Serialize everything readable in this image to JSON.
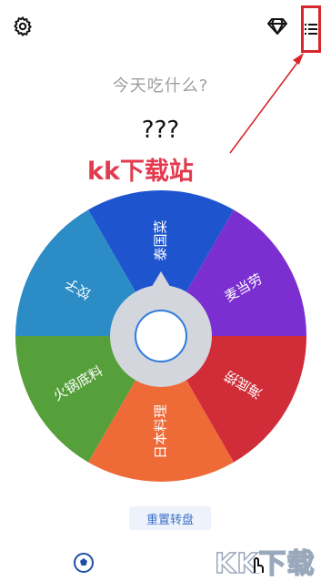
{
  "header": {
    "settings_icon": "gear-icon",
    "vip_icon": "diamond-icon",
    "list_icon": "list-icon"
  },
  "prompt": {
    "question": "今天吃什么?",
    "result": "???"
  },
  "watermark_top": "kk下载站",
  "wheel": {
    "segments": [
      {
        "label": "泰国菜",
        "color": "#1e55cf"
      },
      {
        "label": "麦当劳",
        "color": "#7b2fd0"
      },
      {
        "label": "海底捞",
        "color": "#d12d38"
      },
      {
        "label": "日本料理",
        "color": "#ee6a36"
      },
      {
        "label": "火锅底料",
        "color": "#56a03b"
      },
      {
        "label": "饺子",
        "color": "#2c8cc5"
      }
    ],
    "center_button_icon": "circle-spin-icon"
  },
  "reset_label": "重置转盘",
  "bottom": {
    "icon": "soccer-ball-icon",
    "watermark": "KK下载",
    "cursor_icon": "hand-cursor-icon"
  },
  "colors": {
    "highlight": "#d8262b",
    "reset_text": "#3b6fc7"
  }
}
